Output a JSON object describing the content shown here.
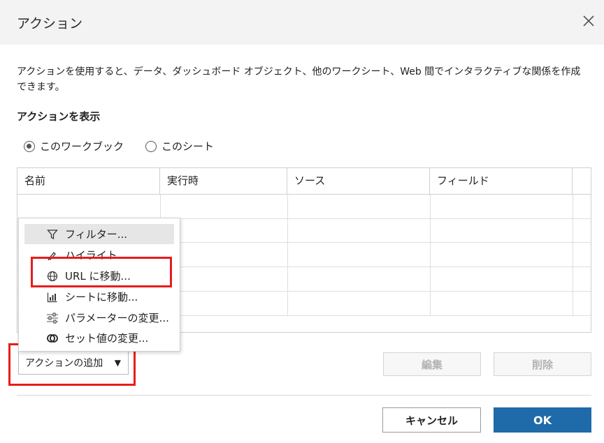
{
  "dialog": {
    "title": "アクション",
    "close_icon": "close-icon",
    "description": "アクションを使用すると、データ、ダッシュボード オブジェクト、他のワークシート、Web 間でインタラクティブな関係を作成できます。"
  },
  "show_actions": {
    "label": "アクションを表示",
    "options": [
      {
        "label": "このワークブック",
        "selected": true
      },
      {
        "label": "このシート",
        "selected": false
      }
    ]
  },
  "table": {
    "columns": [
      "名前",
      "実行時",
      "ソース",
      "フィールド"
    ],
    "rows": []
  },
  "menu": {
    "items": [
      {
        "label": "フィルター...",
        "icon": "filter-icon"
      },
      {
        "label": "ハイライト...",
        "icon": "highlight-pen-icon"
      },
      {
        "label": "URL に移動...",
        "icon": "globe-icon"
      },
      {
        "label": "シートに移動...",
        "icon": "sheet-chart-icon"
      },
      {
        "label": "パラメーターの変更...",
        "icon": "sliders-icon"
      },
      {
        "label": "セット値の変更...",
        "icon": "set-circles-icon"
      }
    ]
  },
  "buttons": {
    "add_action": "アクションの追加",
    "edit": "編集",
    "delete": "削除",
    "cancel": "キャンセル",
    "ok": "OK"
  },
  "colors": {
    "ok_button": "#1f6aa8",
    "highlight_box": "#e81c1c",
    "header_bg": "#f3f3f3"
  }
}
